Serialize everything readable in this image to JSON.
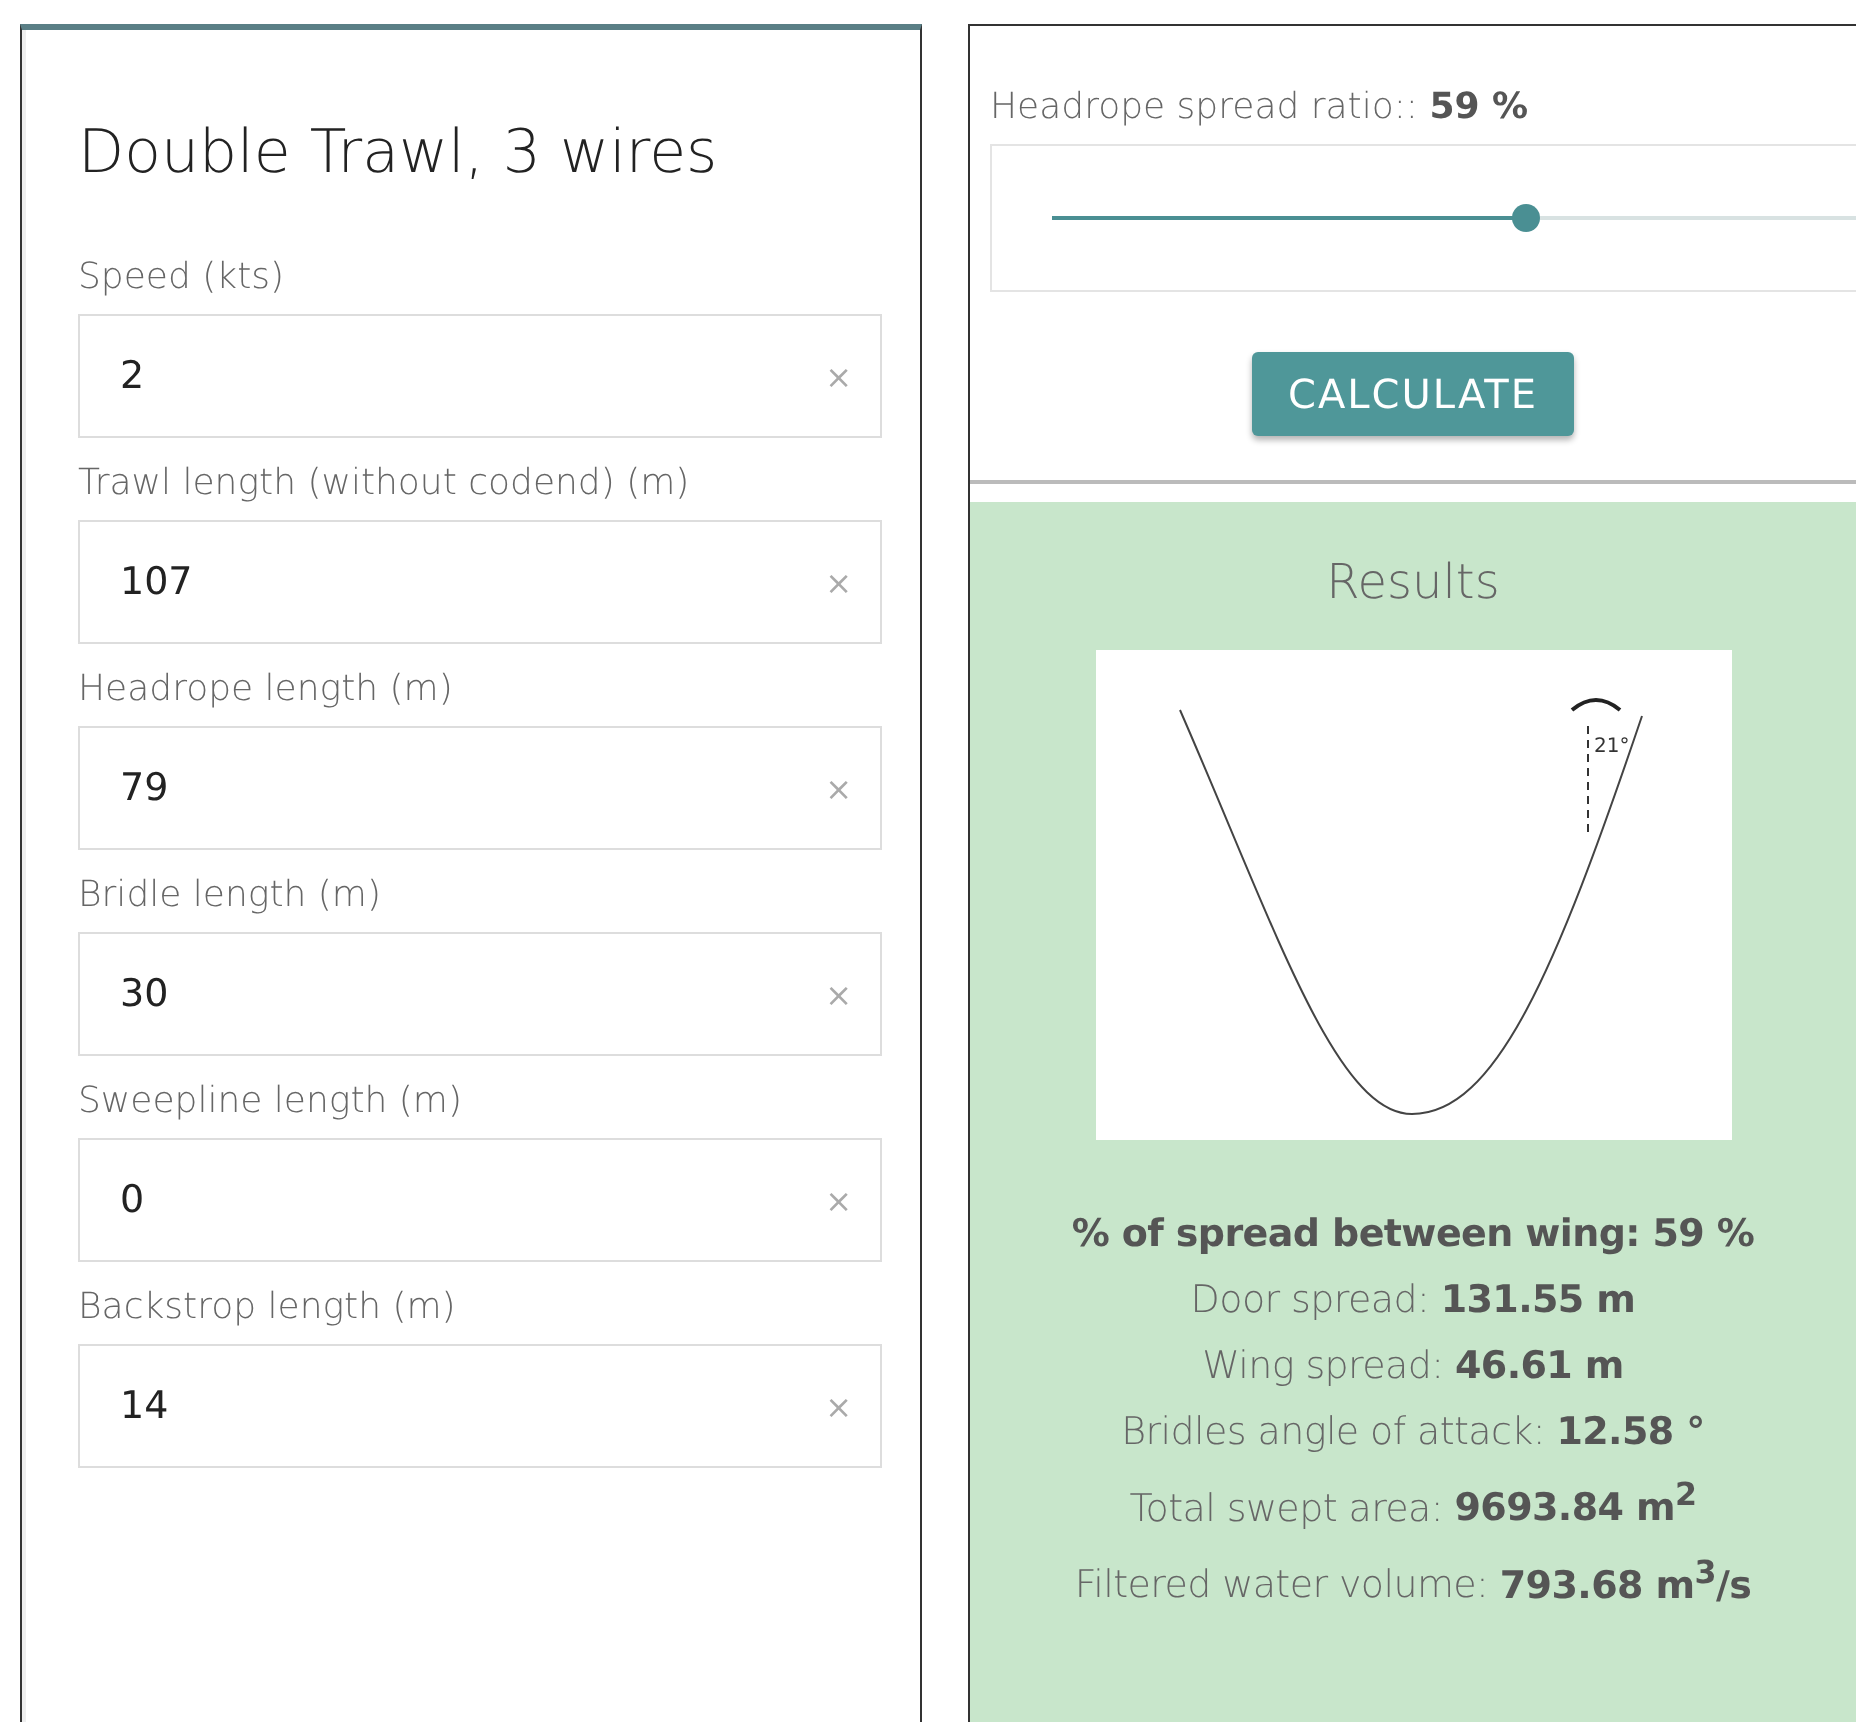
{
  "form": {
    "title": "Double Trawl, 3 wires",
    "fields": [
      {
        "label": "Speed (kts)",
        "value": "2",
        "clear": "×"
      },
      {
        "label": "Trawl length (without codend) (m)",
        "value": "107",
        "clear": "×"
      },
      {
        "label": "Headrope length (m)",
        "value": "79",
        "clear": "×"
      },
      {
        "label": "Bridle length (m)",
        "value": "30",
        "clear": "×"
      },
      {
        "label": "Sweepline length (m)",
        "value": "0",
        "clear": "×"
      },
      {
        "label": "Backstrop length (m)",
        "value": "14",
        "clear": "×"
      }
    ]
  },
  "slider": {
    "label": "Headrope spread ratio::",
    "reading": "59 %",
    "level": 0.59
  },
  "calculate_button": "CALCULATE",
  "results": {
    "title": "Results",
    "diagram_angle": "21°",
    "lines": [
      {
        "kind": "summary",
        "text": "% of spread between wing: 59 %"
      },
      {
        "kind": "value",
        "text": "Door spread: **131.55 m**"
      },
      {
        "kind": "value",
        "text": "Wing spread: **46.61 m**"
      },
      {
        "kind": "value",
        "text": "Bridles angle of attack: **12.58 °**"
      },
      {
        "kind": "value",
        "text": "Total swept area: **9693.84 m$^{2}$**"
      },
      {
        "kind": "value",
        "text": "Filtered water volume: **793.68 m$^{3}$/s**"
      }
    ]
  }
}
